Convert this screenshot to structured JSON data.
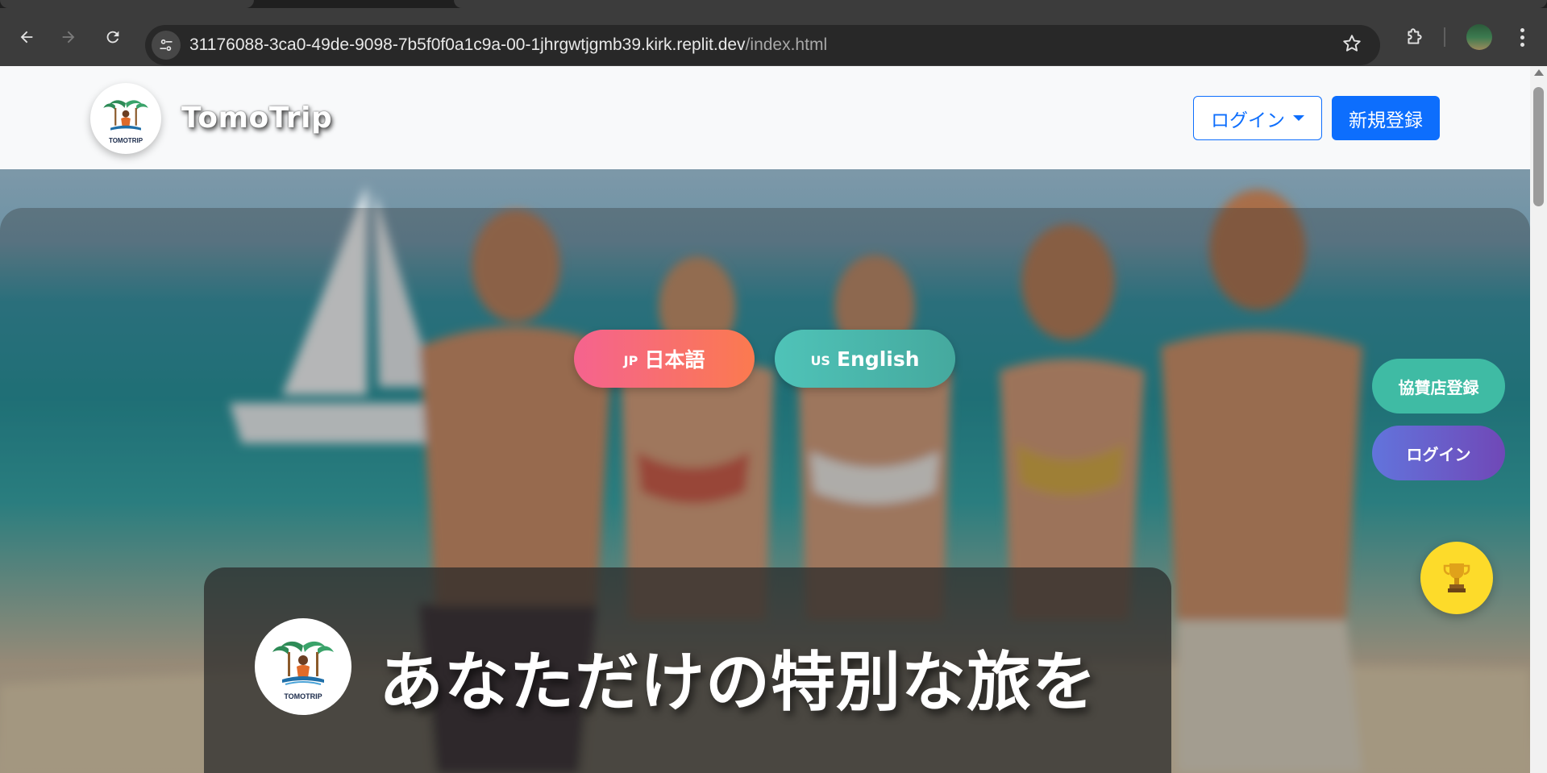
{
  "browser": {
    "url_host": "31176088-3ca0-49de-9098-7b5f0f0a1c9a-00-1jhrgwtjgmb39.kirk.replit.dev",
    "url_path": "/index.html",
    "back_icon": "arrow-left-icon",
    "forward_icon": "arrow-right-icon",
    "reload_icon": "reload-icon",
    "site_info_icon": "tune-icon",
    "bookmark_icon": "star-icon",
    "extensions_icon": "puzzle-icon",
    "menu_icon": "kebab-icon"
  },
  "header": {
    "brand": "TomoTrip",
    "logo_text": "TOMOTRIP",
    "login_label": "ログイン",
    "signup_label": "新規登録",
    "bg_color": "#f8f9fa",
    "accent": "#0d6efd"
  },
  "hero": {
    "lang_jp": {
      "flag": "JP",
      "label": "日本語"
    },
    "lang_en": {
      "flag": "US",
      "label": "English"
    },
    "sponsor_label": "協賛店登録",
    "side_login_label": "ログイン",
    "title": "あなただけの特別な旅を",
    "card_logo_text": "TOMOTRIP",
    "trophy_icon": "trophy-icon"
  }
}
